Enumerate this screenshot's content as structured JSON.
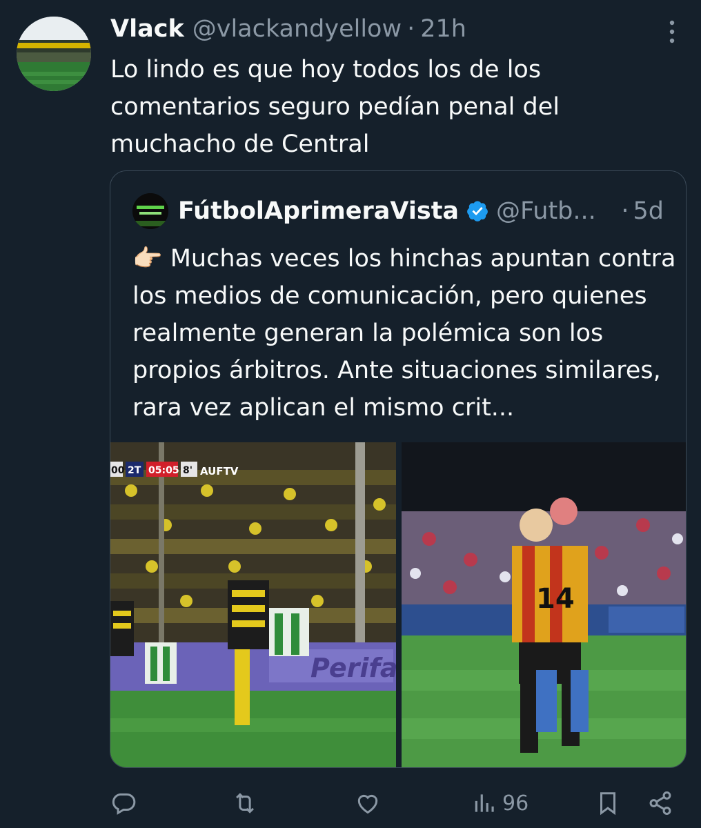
{
  "tweet": {
    "author_name": "Vlack",
    "author_handle": "@vlackandyellow",
    "separator": "·",
    "time": "21h",
    "text": "Lo lindo es que hoy todos los de los comentarios seguro pedían penal del muchacho de Central"
  },
  "quote": {
    "author_name": "FútbolAprimeraVista",
    "author_handle": "@Futb...",
    "separator": "·",
    "time": "5d",
    "emoji": "👉🏻",
    "text": "Muchas veces los hinchas apuntan contra los medios de comunicación, pero quienes realmente generan la polémica son los propios árbitros. Ante situaciones similares, rara vez aplican el mismo crit...",
    "scoreboard": {
      "left": "00",
      "period": "2T",
      "clock": "05:05",
      "minute": "8'",
      "channel": "AUFTV"
    },
    "ad_board": "Perifar",
    "player_number": "14"
  },
  "actions": {
    "views_count": "96"
  },
  "icons": [
    "more-icon",
    "verified-icon",
    "reply-icon",
    "retweet-icon",
    "like-icon",
    "views-icon",
    "bookmark-icon",
    "share-icon"
  ],
  "colors": {
    "background": "#15202b",
    "text": "#f7f9f9",
    "muted": "#8b98a5",
    "verified": "#1d9bf0",
    "border": "#3b4a58"
  }
}
